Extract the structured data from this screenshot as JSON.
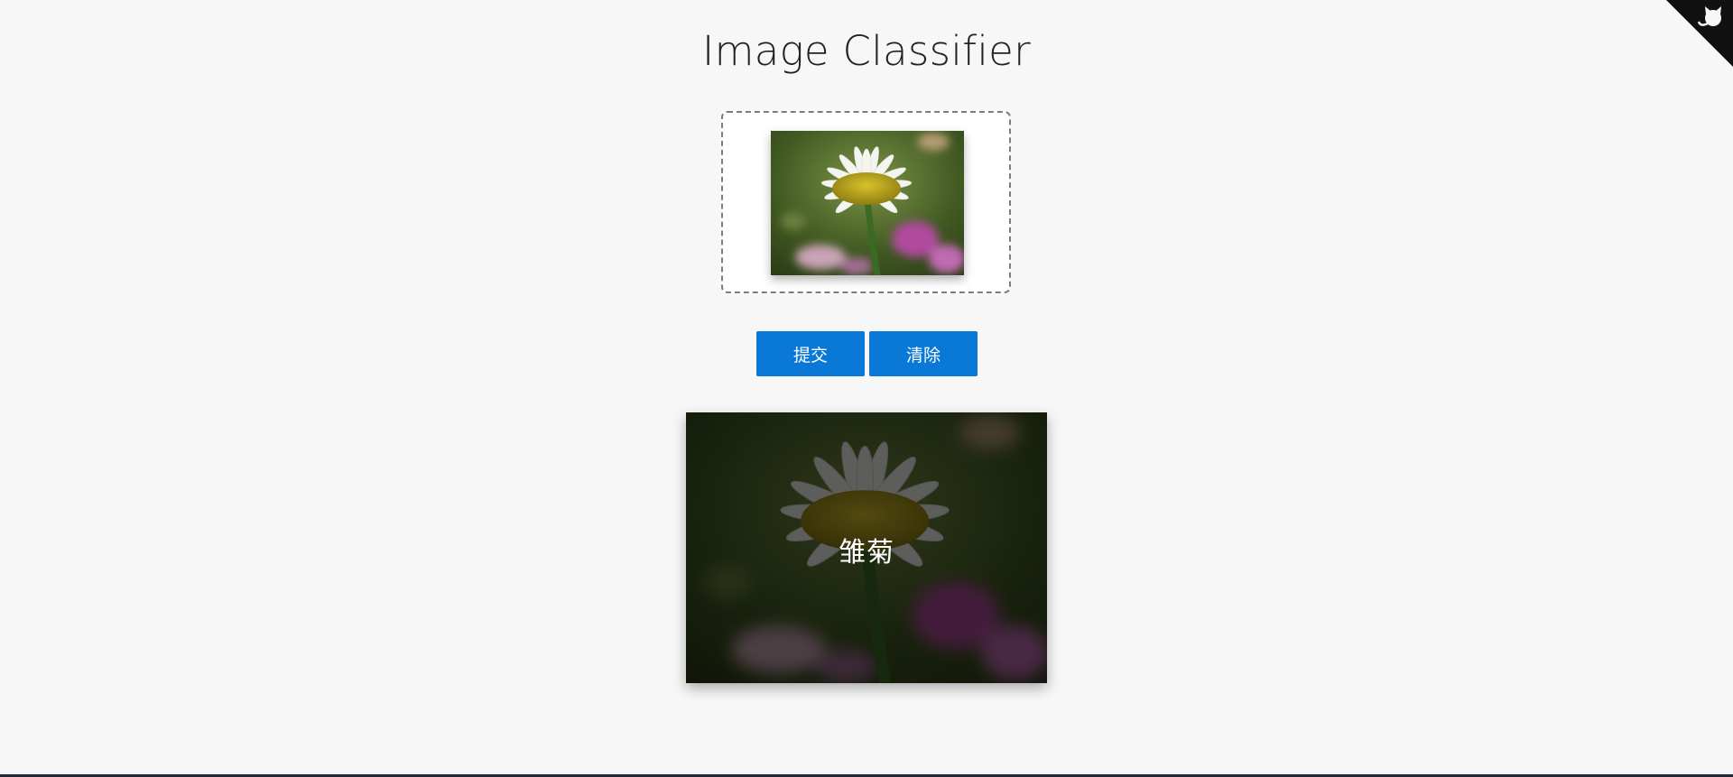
{
  "page": {
    "title": "Image Classifier"
  },
  "corner": {
    "icon": "github-icon",
    "color": "#111111"
  },
  "upload_area": {
    "preview_icon": "daisy-photo"
  },
  "buttons": {
    "submit_label": "提交",
    "clear_label": "清除",
    "color": "#0a78d7"
  },
  "result": {
    "label": "雏菊"
  }
}
